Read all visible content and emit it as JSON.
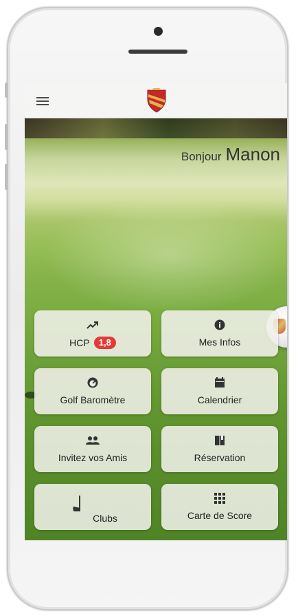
{
  "greeting": {
    "hello": "Bonjour",
    "name": "Manon"
  },
  "tiles": [
    {
      "label": "HCP",
      "icon": "trending-up-icon",
      "badge": "1,8"
    },
    {
      "label": "Mes Infos",
      "icon": "info-icon"
    },
    {
      "label": "Golf Baromètre",
      "icon": "gauge-icon"
    },
    {
      "label": "Calendrier",
      "icon": "calendar-icon"
    },
    {
      "label": "Invitez vos Amis",
      "icon": "people-icon"
    },
    {
      "label": "Réservation",
      "icon": "book-icon"
    },
    {
      "label": "Clubs",
      "icon": "golf-club-icon"
    },
    {
      "label": "Carte de Score",
      "icon": "grid-icon"
    }
  ],
  "colors": {
    "badge": "#e53935",
    "topbar": "#f5f5f3",
    "tile_bg": "#f0f0e9",
    "logo_red": "#c62828",
    "logo_gold": "#e0b64a"
  }
}
